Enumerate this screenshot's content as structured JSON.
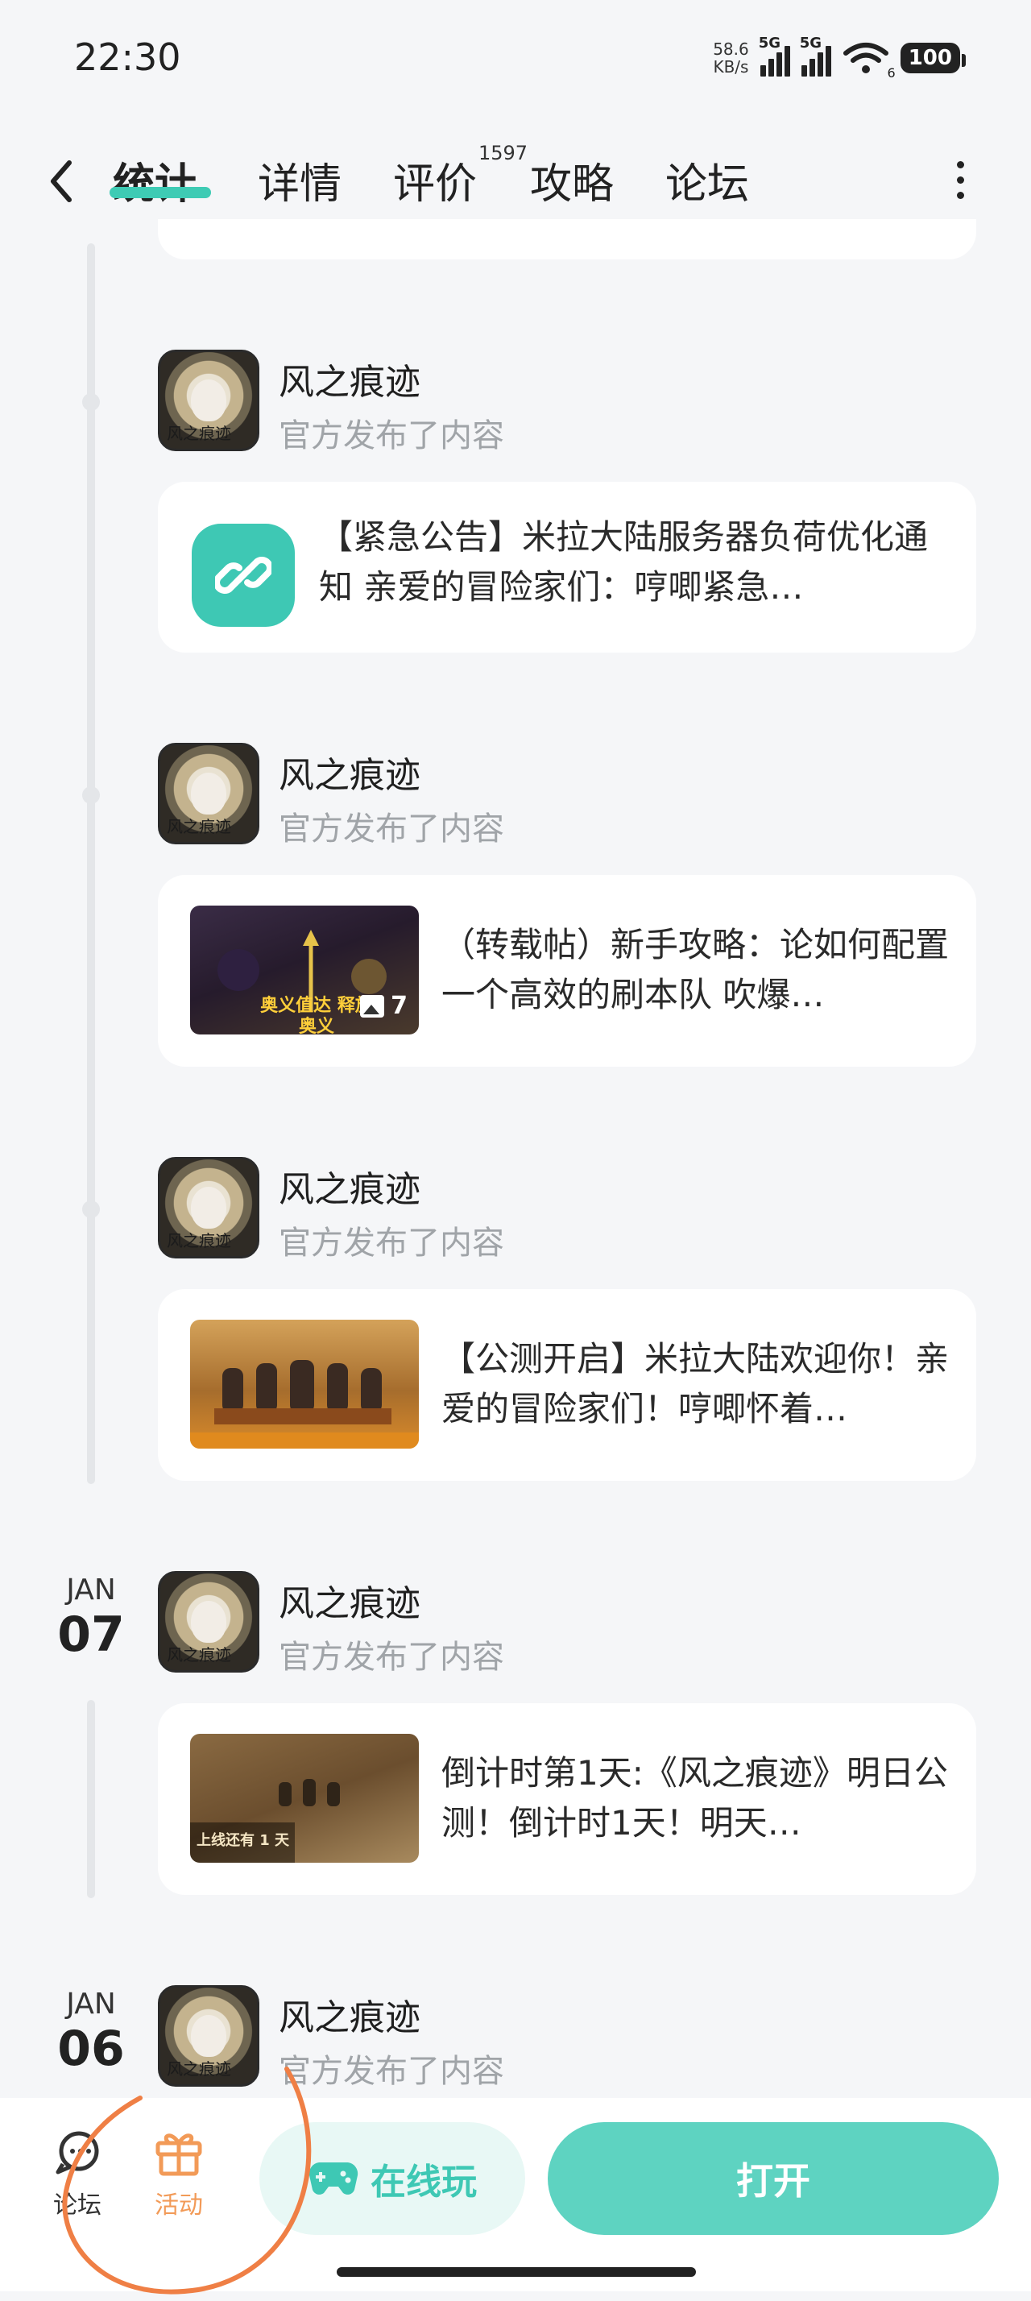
{
  "status_bar": {
    "time": "22:30",
    "net_speed_value": "58.6",
    "net_speed_unit": "KB/s",
    "signal1_label": "5G",
    "signal2_label": "5G",
    "wifi_sub": "6",
    "battery": "100"
  },
  "nav": {
    "tabs": [
      {
        "label": "统计",
        "active": true
      },
      {
        "label": "详情",
        "active": false
      },
      {
        "label": "评价",
        "active": false
      },
      {
        "label": "攻略",
        "active": false
      },
      {
        "label": "论坛",
        "active": false
      }
    ],
    "review_count": "1597",
    "accent_color": "#3ecbb4"
  },
  "feed": {
    "posts": [
      {
        "author": "风之痕迹",
        "action": "官方发布了内容",
        "card_text": "【紧急公告】米拉大陆服务器负荷优化通知 亲爱的冒险家们：哼唧紧急…",
        "card_type": "link",
        "icon": "link-icon"
      },
      {
        "author": "风之痕迹",
        "action": "官方发布了内容",
        "card_text": "（转载帖）新手攻略：论如何配置一个高效的刷本队 吹爆…",
        "card_type": "image",
        "thumb_caption": "奥义值达 释放奥义",
        "image_count": "7"
      },
      {
        "author": "风之痕迹",
        "action": "官方发布了内容",
        "card_text": "【公测开启】米拉大陆欢迎你！亲爱的冒险家们！哼唧怀着…",
        "card_type": "image"
      },
      {
        "date_month": "JAN",
        "date_day": "07",
        "author": "风之痕迹",
        "action": "官方发布了内容",
        "card_text": "倒计时第1天:《风之痕迹》明日公测！倒计时1天！明天…",
        "card_type": "image",
        "thumb_caption": "上线还有 1 天"
      },
      {
        "date_month": "JAN",
        "date_day": "06",
        "author": "风之痕迹",
        "action": "官方发布了内容"
      }
    ],
    "avatar_logo_text": "风之痕迹"
  },
  "bottom_bar": {
    "forum_label": "论坛",
    "activity_label": "活动",
    "online_play_label": "在线玩",
    "open_label": "打开",
    "activity_color": "#f29a57",
    "primary_color": "#5ed3c1"
  }
}
